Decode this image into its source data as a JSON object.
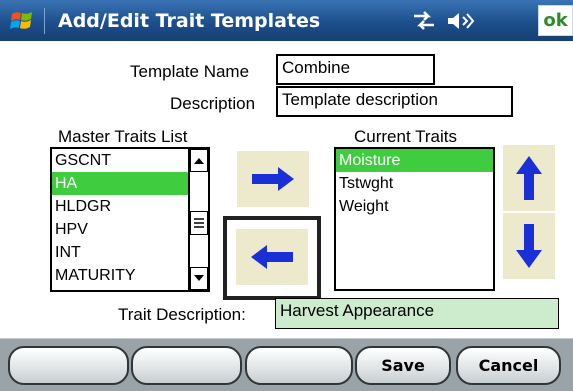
{
  "title_bar": {
    "title": "Add/Edit Trait Templates",
    "ok_label": "ok",
    "icons": [
      "windows-start-icon",
      "network-sync-icon",
      "volume-icon"
    ]
  },
  "form": {
    "template_name_label": "Template Name",
    "template_name_value": "Combine",
    "description_label": "Description",
    "description_value": "Template description",
    "master_list_label": "Master Traits List",
    "master_list_items": [
      "GSCNT",
      "HA",
      "HLDGR",
      "HPV",
      "INT",
      "MATURITY"
    ],
    "master_list_selected": "HA",
    "current_list_label": "Current Traits",
    "current_list_items": [
      "Moisture",
      "Tstwght",
      "Weight"
    ],
    "current_list_selected": "Moisture",
    "trait_description_label": "Trait Description:",
    "trait_description_value": "Harvest Appearance"
  },
  "buttons": {
    "add_trait": "right-arrow-icon",
    "remove_trait": "left-arrow-icon",
    "move_up": "up-arrow-icon",
    "move_down": "down-arrow-icon"
  },
  "toolbar": {
    "buttons": [
      "",
      "",
      "",
      "Save",
      "Cancel"
    ]
  },
  "colors": {
    "title_bar": "#1c4f8c",
    "selection": "#3fcc3f",
    "arrow": "#1a2fd6",
    "trait_description_bg": "#cdeccd",
    "arrow_button_bg": "#ece9cc"
  }
}
